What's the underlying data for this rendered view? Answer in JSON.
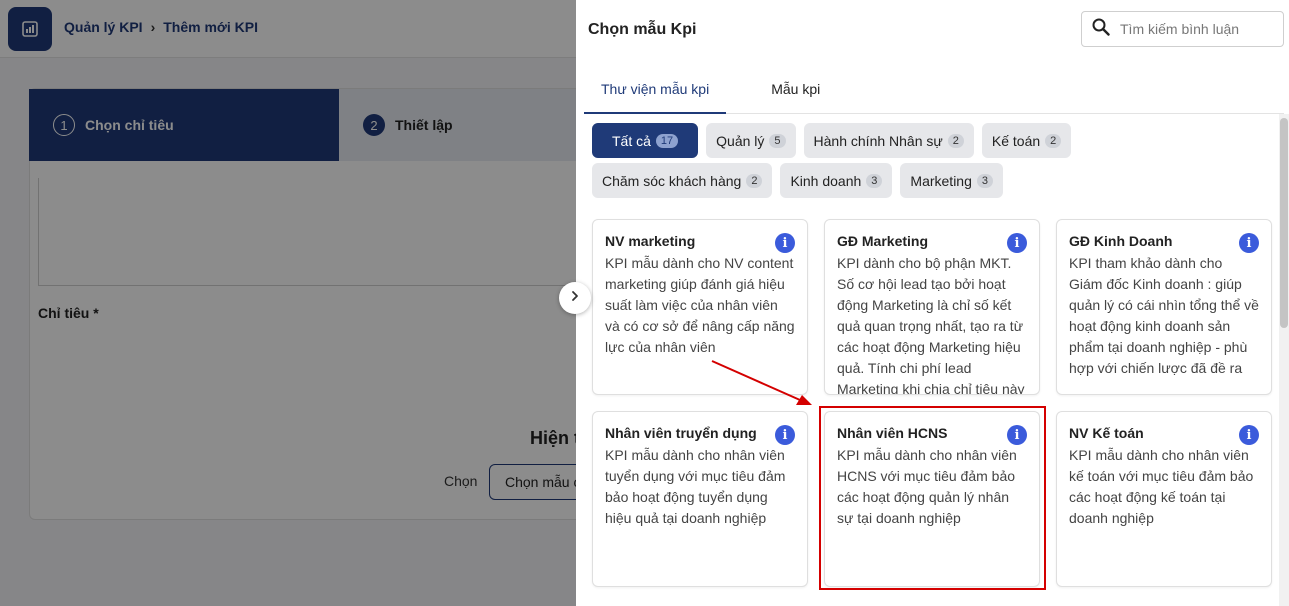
{
  "breadcrumb": {
    "root": "Quản lý KPI",
    "current": "Thêm mới KPI"
  },
  "steps": [
    {
      "num": "1",
      "label": "Chọn chỉ tiêu"
    },
    {
      "num": "2",
      "label": "Thiết lập"
    }
  ],
  "form": {
    "chitieu_label": "Chỉ tiêu *",
    "empty_title": "Hiện t",
    "choose_text": "Chọn",
    "choose_button": "Chọn mẫu c"
  },
  "drawer": {
    "title": "Chọn mẫu Kpi",
    "search_placeholder": "Tìm kiếm bình luận",
    "tabs": [
      "Thư viện mẫu kpi",
      "Mẫu kpi"
    ],
    "categories": [
      {
        "label": "Tất cả",
        "count": "17",
        "active": true
      },
      {
        "label": "Quản lý",
        "count": "5"
      },
      {
        "label": "Hành chính Nhân sự",
        "count": "2"
      },
      {
        "label": "Kế toán",
        "count": "2"
      },
      {
        "label": "Chăm sóc khách hàng",
        "count": "2"
      },
      {
        "label": "Kinh doanh",
        "count": "3"
      },
      {
        "label": "Marketing",
        "count": "3"
      }
    ],
    "cards": [
      {
        "title": "NV marketing",
        "desc": "KPI mẫu dành cho NV content marketing giúp đánh giá hiệu suất làm việc của nhân viên và có cơ sở để nâng cấp năng lực của nhân viên"
      },
      {
        "title": "GĐ Marketing",
        "desc": "KPI dành cho bộ phận MKT. Số cơ hội lead tạo bởi hoạt động Marketing là chỉ số kết quả quan trọng nhất, tạo ra từ các hoạt động Marketing hiệu quả. Tính chi phí lead Marketing khi chia chỉ tiêu này"
      },
      {
        "title": "GĐ Kinh Doanh",
        "desc": "KPI tham khảo dành cho Giám đốc Kinh doanh : giúp quản lý có cái nhìn tổng thể về hoạt động kinh doanh sản phẩm tại doanh nghiệp - phù hợp với chiến lược đã đề ra"
      },
      {
        "title": "Nhân viên truyển dụng",
        "desc": "KPI mẫu dành cho nhân viên tuyển dụng với mục tiêu đảm bảo hoạt động tuyển dụng hiệu quả tại doanh nghiệp"
      },
      {
        "title": "Nhân viên HCNS",
        "desc": "KPI mẫu dành cho nhân viên HCNS với mục tiêu đảm bảo các hoạt động quản lý nhân sự tại doanh nghiệp"
      },
      {
        "title": "NV Kế toán",
        "desc": "KPI mẫu dành cho nhân viên kế toán với mục tiêu đảm bảo các hoạt động kế toán tại doanh nghiệp"
      }
    ]
  },
  "colors": {
    "primary": "#1f3a78",
    "info": "#3b5bdb",
    "highlight": "#d40000"
  }
}
